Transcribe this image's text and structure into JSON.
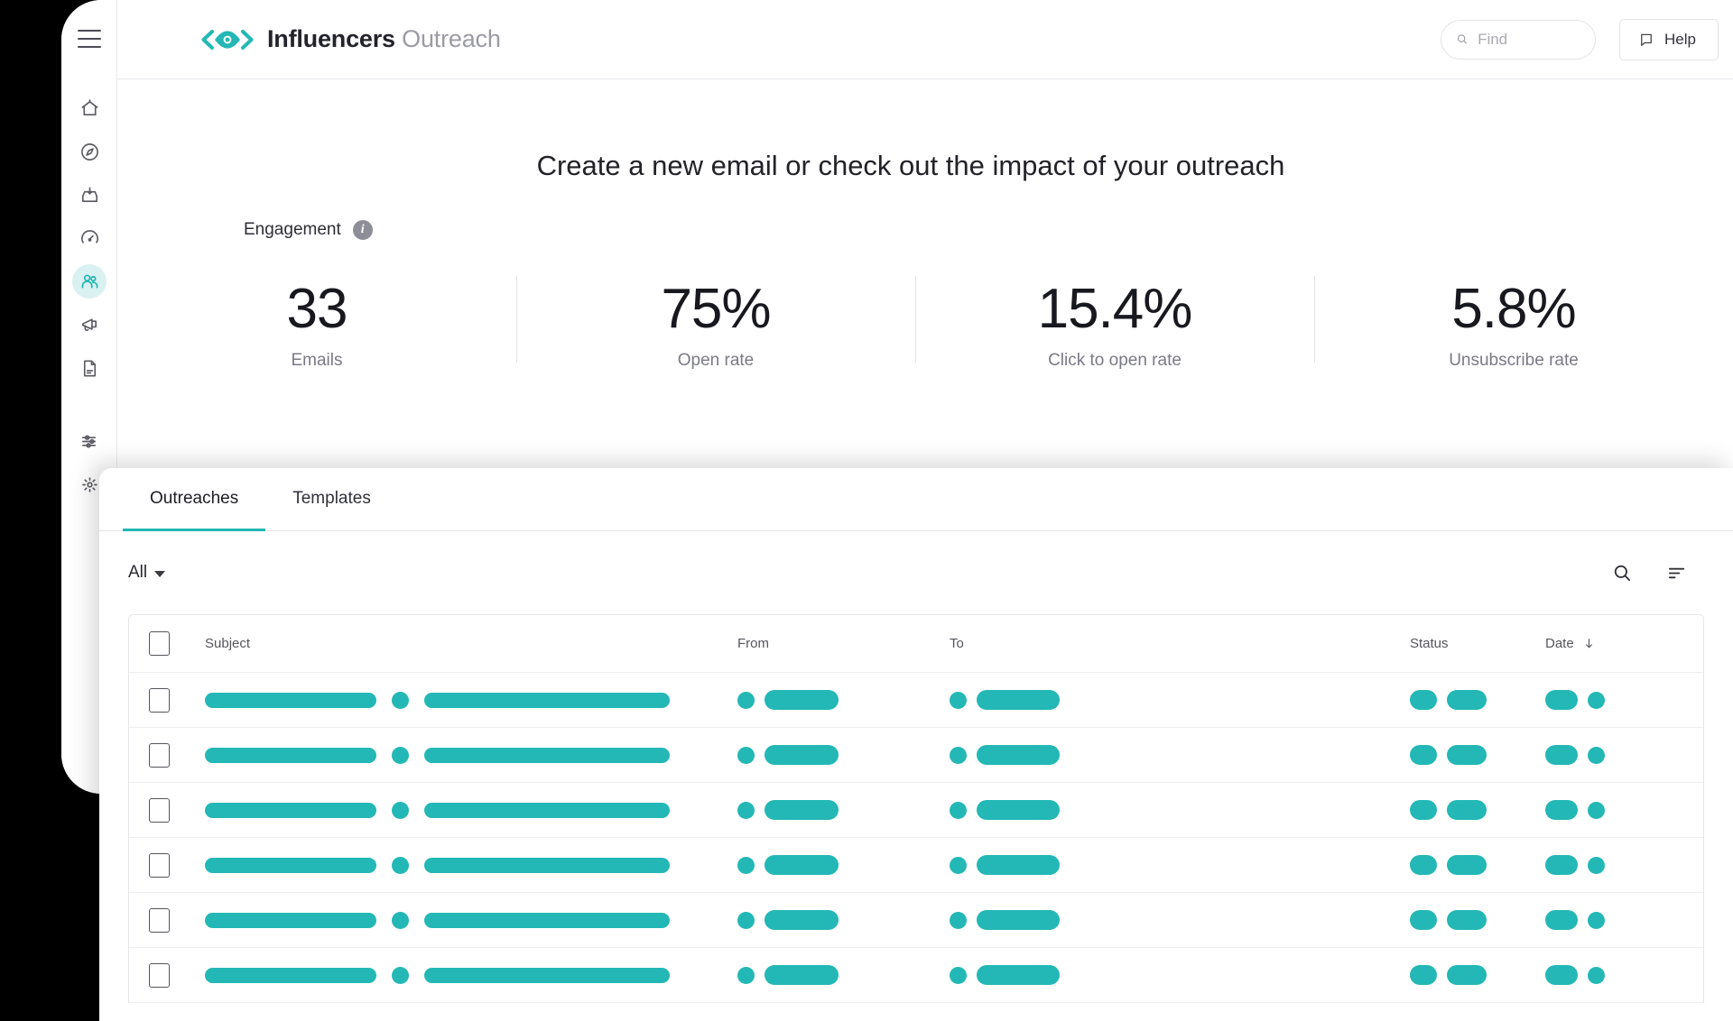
{
  "brand": {
    "name_bold": "Influencers",
    "name_light": "Outreach",
    "logo_icon": "eye-brackets-logo",
    "accent_color": "#23b8b5"
  },
  "topbar": {
    "menu_icon": "hamburger-icon",
    "search": {
      "icon": "search-icon",
      "placeholder": "Find",
      "value": ""
    },
    "help": {
      "icon": "help-book-icon",
      "label": "Help"
    }
  },
  "sidebar": {
    "top_items": [
      {
        "icon": "home-icon",
        "name": "home",
        "active": false
      },
      {
        "icon": "compass-icon",
        "name": "discover",
        "active": false
      },
      {
        "icon": "inbox-download-icon",
        "name": "inbox",
        "active": false
      },
      {
        "icon": "gauge-icon",
        "name": "performance",
        "active": false
      },
      {
        "icon": "people-icon",
        "name": "influencers",
        "active": true
      },
      {
        "icon": "megaphone-icon",
        "name": "campaigns",
        "active": false
      },
      {
        "icon": "document-icon",
        "name": "reports",
        "active": false
      }
    ],
    "bottom_items": [
      {
        "icon": "sliders-icon",
        "name": "preferences",
        "active": false
      },
      {
        "icon": "gear-icon",
        "name": "settings",
        "active": false
      }
    ]
  },
  "main": {
    "headline": "Create a new email or check out the impact of your outreach",
    "engagement": {
      "label": "Engagement",
      "info_icon": "info-icon",
      "info_glyph": "i"
    },
    "metrics": [
      {
        "value": "33",
        "caption": "Emails"
      },
      {
        "value": "75%",
        "caption": "Open rate"
      },
      {
        "value": "15.4%",
        "caption": "Click to open rate"
      },
      {
        "value": "5.8%",
        "caption": "Unsubscribe rate"
      }
    ]
  },
  "panel": {
    "tabs": [
      {
        "label": "Outreaches",
        "active": true
      },
      {
        "label": "Templates",
        "active": false
      }
    ],
    "toolbar": {
      "filter_label": "All",
      "filter_caret_icon": "chevron-down-icon",
      "search_icon": "search-icon",
      "sort_icon": "sort-lines-icon"
    },
    "table": {
      "columns": {
        "subject": "Subject",
        "from": "From",
        "to": "To",
        "status": "Status",
        "date": "Date"
      },
      "sorted_column": "Date",
      "sort_direction_icon": "arrow-down-icon",
      "select_all_checkbox": false,
      "skeleton_row_count": 6,
      "skeleton_color": "#23b8b5",
      "row_layout": {
        "subject": [
          "bar-200",
          "dot",
          "bar-280"
        ],
        "from": [
          "dot",
          "bar-80"
        ],
        "to": [
          "dot",
          "bar-90"
        ],
        "status": [
          "bar-28",
          "bar-42"
        ],
        "date": [
          "bar-34",
          "dot"
        ]
      }
    }
  }
}
